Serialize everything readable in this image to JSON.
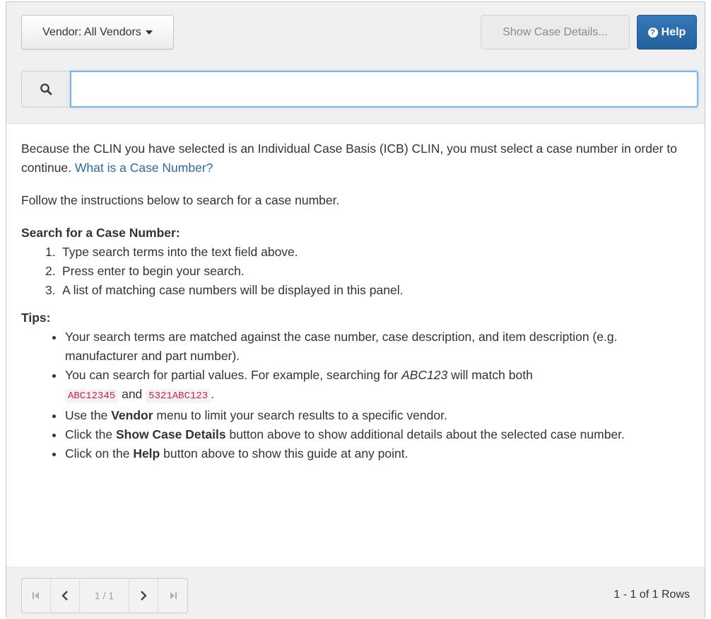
{
  "toolbar": {
    "vendor_label": "Vendor: All Vendors",
    "show_details_label": "Show Case Details...",
    "help_label": "Help"
  },
  "search": {
    "value": "",
    "placeholder": ""
  },
  "content": {
    "intro_text": "Because the CLIN you have selected is an Individual Case Basis (ICB) CLIN, you must select a case number in order to continue.",
    "intro_link": "What is a Case Number?",
    "follow_text": "Follow the instructions below to search for a case number.",
    "search_heading": "Search for a Case Number:",
    "steps": [
      "Type search terms into the text field above.",
      "Press enter to begin your search.",
      "A list of matching case numbers will be displayed in this panel."
    ],
    "tips_heading": "Tips:",
    "tips": {
      "t1": "Your search terms are matched against the case number, case description, and item description (e.g. manufacturer and part number).",
      "t2_a": "You can search for partial values. For example, searching for",
      "t2_em": "ABC123",
      "t2_b": "will match both",
      "t2_code1": "ABC12345",
      "t2_and": "and",
      "t2_code2": "5321ABC123",
      "t2_end": ".",
      "t3_a": "Use the",
      "t3_b": "Vendor",
      "t3_c": "menu to limit your search results to a specific vendor.",
      "t4_a": "Click the",
      "t4_b": "Show Case Details",
      "t4_c": "button above to show additional details about the selected case number.",
      "t5_a": "Click on the",
      "t5_b": "Help",
      "t5_c": "button above to show this guide at any point."
    }
  },
  "footer": {
    "page_label": "1 / 1",
    "rows_label": "1 - 1 of 1 Rows"
  },
  "icons": {
    "search": "search-icon",
    "help": "question-circle-icon",
    "first": "first-page-icon",
    "prev": "prev-page-icon",
    "next": "next-page-icon",
    "last": "last-page-icon"
  },
  "colors": {
    "primary": "#23619c",
    "link": "#2a6aa8",
    "code": "#c7254e",
    "focus": "#7fb1e3"
  }
}
